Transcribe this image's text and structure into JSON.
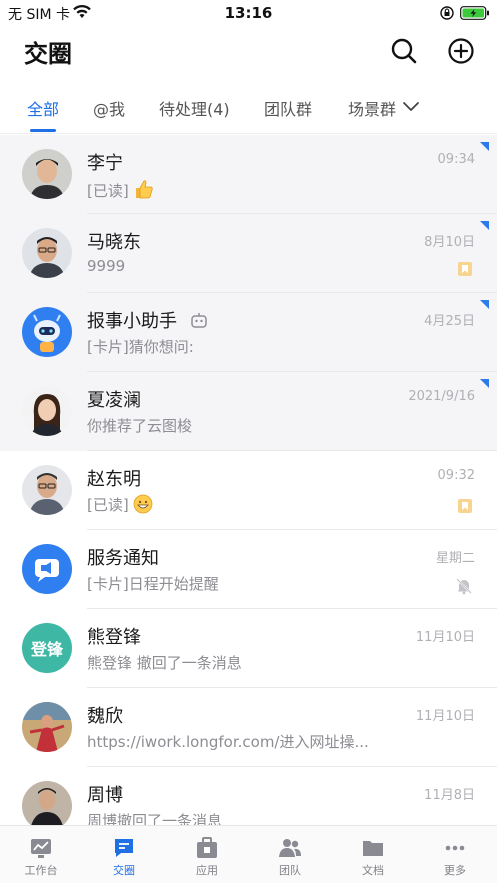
{
  "status_bar": {
    "carrier": "无 SIM 卡",
    "time": "13:16"
  },
  "header": {
    "title": "交圈",
    "search_icon": "search-icon",
    "add_icon": "plus-circle-icon"
  },
  "tabs": [
    {
      "label": "全部",
      "active": true
    },
    {
      "label": "@我",
      "active": false
    },
    {
      "label": "待处理(4)",
      "active": false
    },
    {
      "label": "团队群",
      "active": false
    },
    {
      "label": "场景群",
      "active": false
    }
  ],
  "conversations": [
    {
      "name": "李宁",
      "preview": "[已读]",
      "preview_emoji": "thumbs-up",
      "time": "09:34",
      "pinned": true,
      "badge": null
    },
    {
      "name": "马晓东",
      "preview": "9999",
      "time": "8月10日",
      "pinned": true,
      "badge": "bookmark-icon"
    },
    {
      "name": "报事小助手",
      "preview": "[卡片]猜你想问:",
      "time": "4月25日",
      "pinned": true,
      "badge": null,
      "bot": true
    },
    {
      "name": "夏凌澜",
      "preview": "你推荐了云图梭",
      "time": "2021/9/16",
      "pinned": true,
      "badge": null
    },
    {
      "name": "赵东明",
      "preview": "[已读]",
      "preview_emoji": "grin",
      "time": "09:32",
      "pinned": false,
      "badge": "bookmark-icon"
    },
    {
      "name": "服务通知",
      "preview": "[卡片]日程开始提醒",
      "time": "星期二",
      "pinned": false,
      "badge": "mute-icon"
    },
    {
      "name": "熊登锋",
      "avatar_text": "登锋",
      "preview": "熊登锋 撤回了一条消息",
      "time": "11月10日",
      "pinned": false,
      "badge": null
    },
    {
      "name": "魏欣",
      "preview": "https://iwork.longfor.com/进入网址操...",
      "time": "11月10日",
      "pinned": false,
      "badge": null
    },
    {
      "name": "周博",
      "preview": "周博撤回了一条消息",
      "time": "11月8日",
      "pinned": false,
      "badge": null
    }
  ],
  "tabbar": [
    {
      "label": "工作台",
      "icon": "dashboard-icon",
      "active": false
    },
    {
      "label": "交圈",
      "icon": "chat-icon",
      "active": true
    },
    {
      "label": "应用",
      "icon": "apps-box-icon",
      "active": false
    },
    {
      "label": "团队",
      "icon": "team-icon",
      "active": false
    },
    {
      "label": "文档",
      "icon": "folder-icon",
      "active": false
    },
    {
      "label": "更多",
      "icon": "more-icon",
      "active": false
    }
  ],
  "colors": {
    "accent": "#1f6fe5",
    "pin_corner": "#2b7be8",
    "bookmark": "#f5c97a",
    "avatar_teal": "#3fb7a5",
    "avatar_blue": "#2f7ff0"
  }
}
